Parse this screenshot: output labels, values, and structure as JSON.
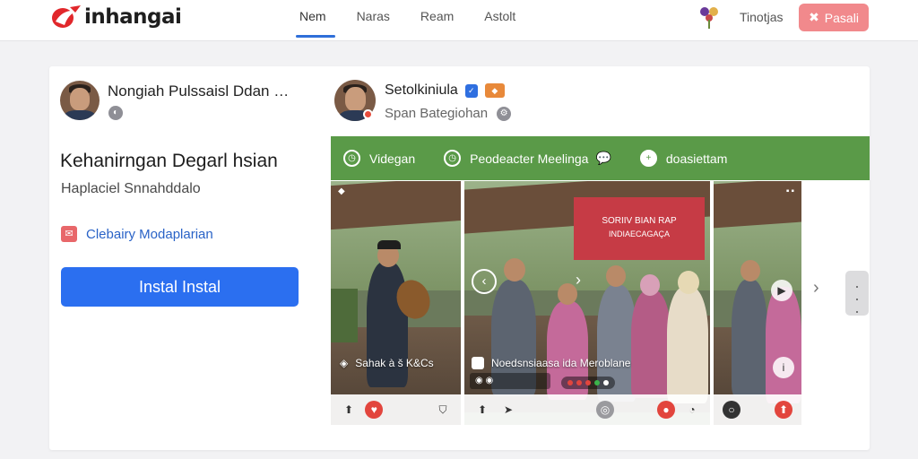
{
  "header": {
    "logo_text": "inhangai",
    "nav": [
      {
        "label": "Nem",
        "active": true
      },
      {
        "label": "Naras",
        "active": false
      },
      {
        "label": "Ream",
        "active": false
      },
      {
        "label": "Astolt",
        "active": false
      }
    ],
    "link_label": "Tinotjas",
    "action_button_label": "Pasali"
  },
  "left_panel": {
    "author_name": "Nongiah Pulssaisl Ddan",
    "more": "…",
    "title": "Kehanirngan Degarl hsian",
    "subtitle": "Haplaciel Snnahddalo",
    "link_label": "Clebairy Modaplarian",
    "install_button_label": "Instal Instal"
  },
  "right_panel": {
    "author_name": "Setolkiniula",
    "subtitle": "Span Bategiohan",
    "tabs": [
      {
        "label": "Videgan",
        "icon": "clock-icon"
      },
      {
        "label": "Peodeacter Meelinga",
        "icon": "clock-icon"
      },
      {
        "label": "doasiettam",
        "icon": "plus-icon"
      }
    ],
    "media": [
      {
        "caption": "Sahak à š K&Cs"
      },
      {
        "caption": "Noedsnsiaasa ida Meroblane",
        "banner_line1": "SORIIV BIAN RAP",
        "banner_line2": "INDIAECAGAÇA"
      },
      {
        "caption": ""
      }
    ]
  },
  "colors": {
    "accent": "#2b6ff0",
    "nav_underline": "#2f6fd9",
    "green_bar": "#5a9a48",
    "header_button": "#f1898c",
    "banner": "#c63b45"
  }
}
